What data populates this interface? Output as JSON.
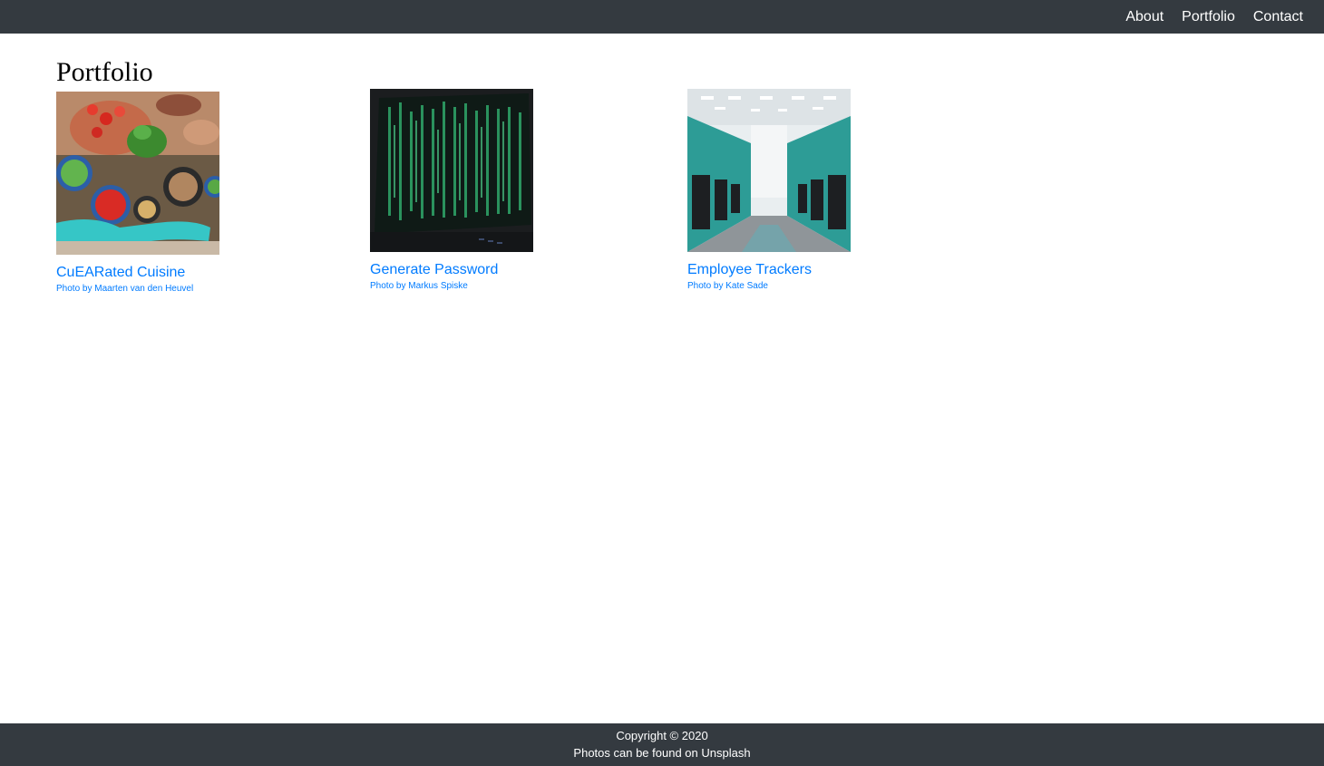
{
  "nav": {
    "links": [
      "About",
      "Portfolio",
      "Contact"
    ]
  },
  "main": {
    "title": "Portfolio",
    "projects": [
      {
        "title": "CuEARated Cuisine",
        "credit": "Photo by Maarten van den Heuvel",
        "image": "vegetables-cooking-photo"
      },
      {
        "title": "Generate Password",
        "credit": "Photo by Markus Spiske",
        "image": "green-code-screen-photo"
      },
      {
        "title": "Employee Trackers",
        "credit": "Photo by Kate Sade",
        "image": "office-cubicles-photo"
      }
    ]
  },
  "footer": {
    "copyright": "Copyright © 2020",
    "note": "Photos can be found on Unsplash"
  },
  "colors": {
    "navbar_bg": "#343a40",
    "link": "#007bff"
  }
}
